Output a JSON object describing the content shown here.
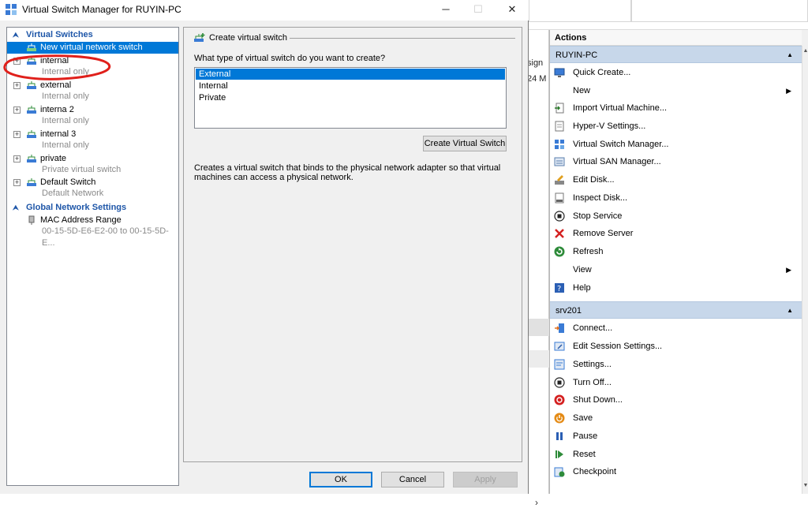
{
  "dialog": {
    "title": "Virtual Switch Manager for RUYIN-PC",
    "left_tree": {
      "category_virtual_switches": "Virtual Switches",
      "new_switch": "New virtual network switch",
      "switches": [
        {
          "name": "internal",
          "type": "Internal only"
        },
        {
          "name": "external",
          "type": "Internal only"
        },
        {
          "name": "interna 2",
          "type": "Internal only"
        },
        {
          "name": "internal 3",
          "type": "Internal only"
        },
        {
          "name": "private",
          "type": "Private virtual switch"
        },
        {
          "name": "Default Switch",
          "type": "Default Network"
        }
      ],
      "category_global": "Global Network Settings",
      "mac_range": {
        "name": "MAC Address Range",
        "value": "00-15-5D-E6-E2-00 to 00-15-5D-E..."
      }
    },
    "right_panel": {
      "group_title": "Create virtual switch",
      "question": "What type of virtual switch do you want to create?",
      "options": [
        "External",
        "Internal",
        "Private"
      ],
      "selected_option": "External",
      "create_button": "Create Virtual Switch",
      "description": "Creates a virtual switch that binds to the physical network adapter so that virtual machines can access a physical network."
    },
    "buttons": {
      "ok": "OK",
      "cancel": "Cancel",
      "apply": "Apply"
    }
  },
  "background": {
    "cut_text_1": "sign",
    "cut_text_2": "24 M",
    "actions_title": "Actions",
    "host_section": "RUYIN-PC",
    "host_actions": [
      "Quick Create...",
      "New",
      "Import Virtual Machine...",
      "Hyper-V Settings...",
      "Virtual Switch Manager...",
      "Virtual SAN Manager...",
      "Edit Disk...",
      "Inspect Disk...",
      "Stop Service",
      "Remove Server",
      "Refresh",
      "View",
      "Help"
    ],
    "vm_section": "srv201",
    "vm_actions": [
      "Connect...",
      "Edit Session Settings...",
      "Settings...",
      "Turn Off...",
      "Shut Down...",
      "Save",
      "Pause",
      "Reset",
      "Checkpoint"
    ]
  },
  "colors": {
    "selection": "#0078d7",
    "category": "#1e56a8",
    "section_header": "#c7d7ea",
    "annotation": "#e0201b"
  }
}
